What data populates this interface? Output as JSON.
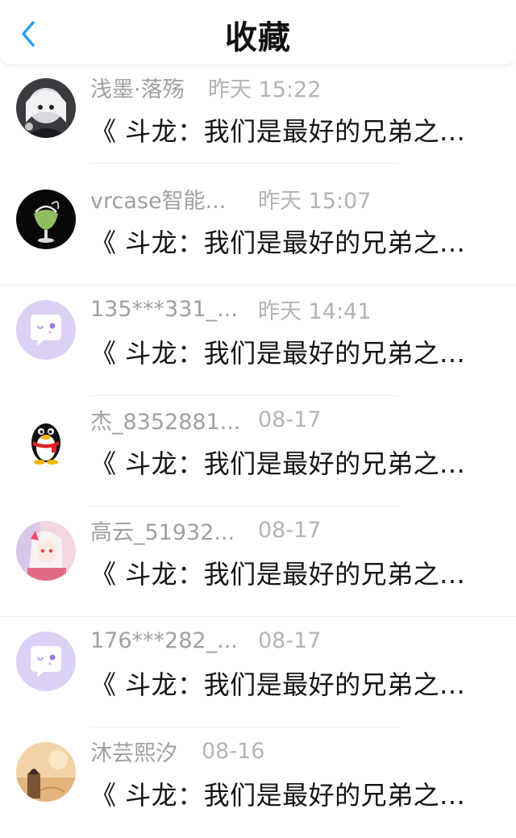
{
  "header": {
    "title": "收藏",
    "back_icon": "chevron-left-icon",
    "accent": "#2d9cf0"
  },
  "items": [
    {
      "name": "浅墨·落殇",
      "time": "昨天 15:22",
      "message": "《 斗龙：我们是最好的兄弟之...",
      "avatar": "anime-girl-dark"
    },
    {
      "name": "vrcase智能...",
      "time": "昨天 15:07",
      "message": "《 斗龙：我们是最好的兄弟之...",
      "avatar": "glass-object-black"
    },
    {
      "name": "135***331_...",
      "time": "昨天 14:41",
      "message": "《 斗龙：我们是最好的兄弟之...",
      "avatar": "chat-bubble-purple"
    },
    {
      "name": "杰_8352881...",
      "time": "08-17",
      "message": "《 斗龙：我们是最好的兄弟之...",
      "avatar": "penguin"
    },
    {
      "name": "高云_51932...",
      "time": "08-17",
      "message": "《 斗龙：我们是最好的兄弟之...",
      "avatar": "anime-girl-pink"
    },
    {
      "name": "176***282_...",
      "time": "08-17",
      "message": "《 斗龙：我们是最好的兄弟之...",
      "avatar": "chat-bubble-purple"
    },
    {
      "name": "沐芸熙汐",
      "time": "08-16",
      "message": "《 斗龙：我们是最好的兄弟之...",
      "avatar": "photo-warm"
    }
  ]
}
